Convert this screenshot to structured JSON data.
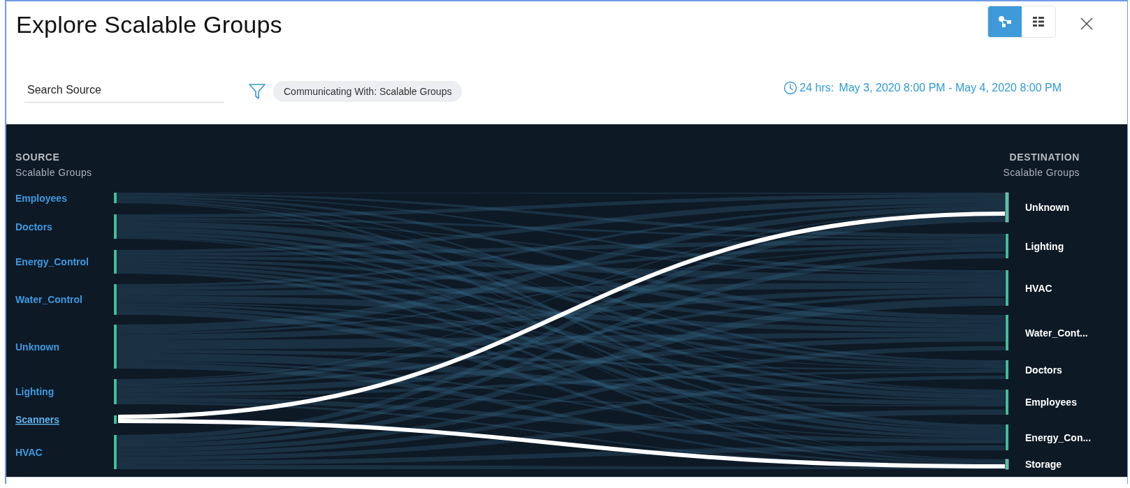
{
  "window": {
    "title": "Explore Scalable Groups"
  },
  "view_toggle": [
    {
      "kind": "graph",
      "selected": true
    },
    {
      "kind": "table",
      "selected": false
    }
  ],
  "search": {
    "placeholder": "Search Source"
  },
  "filter_chip": "Communicating With: Scalable Groups",
  "time_range": {
    "duration": "24 hrs:",
    "range": "May 3, 2020 8:00 PM - May 4, 2020 8:00 PM"
  },
  "diagram": {
    "source_heading": "SOURCE",
    "source_subheading": "Scalable Groups",
    "destination_heading": "DESTINATION",
    "destination_subheading": "Scalable Groups",
    "sources": [
      {
        "label": "Employees",
        "selected": false
      },
      {
        "label": "Doctors",
        "selected": false
      },
      {
        "label": "Energy_Control",
        "selected": false
      },
      {
        "label": "Water_Control",
        "selected": false
      },
      {
        "label": "Unknown",
        "selected": false
      },
      {
        "label": "Lighting",
        "selected": false
      },
      {
        "label": "Scanners",
        "selected": true
      },
      {
        "label": "HVAC",
        "selected": false
      }
    ],
    "destinations": [
      {
        "label": "Unknown",
        "highlighted": true
      },
      {
        "label": "Lighting",
        "highlighted": false
      },
      {
        "label": "HVAC",
        "highlighted": false
      },
      {
        "label": "Water_Cont...",
        "highlighted": false
      },
      {
        "label": "Doctors",
        "highlighted": false
      },
      {
        "label": "Employees",
        "highlighted": false
      },
      {
        "label": "Energy_Con...",
        "highlighted": false
      },
      {
        "label": "Storage",
        "highlighted": true
      }
    ]
  }
}
